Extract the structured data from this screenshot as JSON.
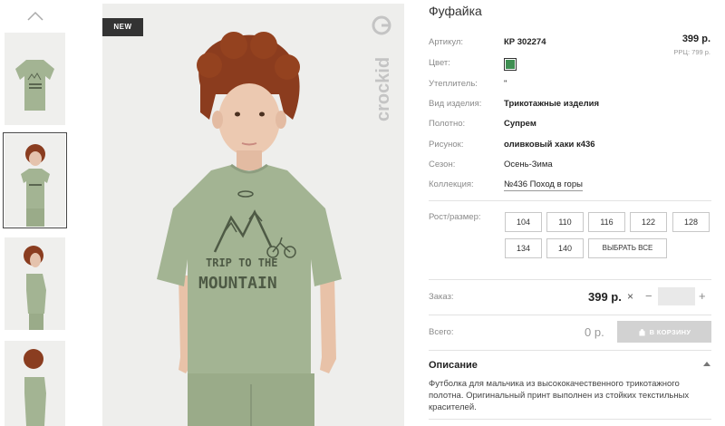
{
  "badge": "NEW",
  "brand": "crockid",
  "product": {
    "title": "Фуфайка",
    "price": "399 р.",
    "rrp": "РРЦ: 799 р."
  },
  "details": [
    {
      "label": "Артикул:",
      "value": "КР 302274",
      "bold": true
    },
    {
      "label": "Цвет:",
      "value": "",
      "color": "#3f8f52"
    },
    {
      "label": "Утеплитель:",
      "value": "\"",
      "bold": false
    },
    {
      "label": "Вид изделия:",
      "value": "Трикотажные изделия",
      "bold": true
    },
    {
      "label": "Полотно:",
      "value": "Супрем",
      "bold": true
    },
    {
      "label": "Рисунок:",
      "value": "оливковый хаки к436",
      "bold": true
    },
    {
      "label": "Сезон:",
      "value": "Осень-Зима",
      "bold": false
    },
    {
      "label": "Коллекция:",
      "value": "№436 Поход в горы",
      "bold": false
    }
  ],
  "sizes": {
    "label": "Рост/размер:",
    "options": [
      "104",
      "110",
      "116",
      "122",
      "128",
      "134",
      "140"
    ],
    "select_all": "ВЫБРАТЬ ВСЕ"
  },
  "order": {
    "label": "Заказ:",
    "price": "399 р.",
    "close": "×",
    "minus": "−",
    "quantity": "",
    "plus": "+"
  },
  "total": {
    "label": "Всего:",
    "value": "0 р.",
    "cart_button": "В КОРЗИНУ"
  },
  "description": {
    "title": "Описание",
    "text": "Футболка для мальчика из высококачественного трикотажного полотна. Оригинальный принт выполнен из стойких текстильных красителей."
  },
  "print_text": {
    "line1": "TRIP TO THE",
    "line2": "MOUNTAIN"
  },
  "colors": {
    "shirt": "#a3b493",
    "background": "#eeeeec",
    "swatch": "#3f8f52"
  }
}
